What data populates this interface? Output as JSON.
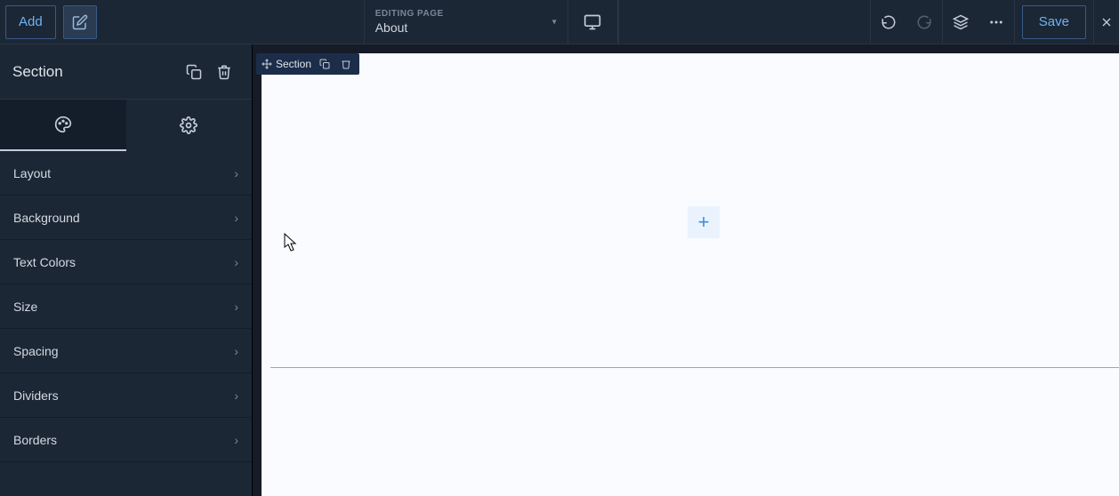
{
  "topbar": {
    "add_label": "Add",
    "page_selector": {
      "label": "EDITING PAGE",
      "name": "About"
    },
    "save_label": "Save"
  },
  "sidebar": {
    "title": "Section",
    "panels": [
      {
        "label": "Layout"
      },
      {
        "label": "Background"
      },
      {
        "label": "Text Colors"
      },
      {
        "label": "Size"
      },
      {
        "label": "Spacing"
      },
      {
        "label": "Dividers"
      },
      {
        "label": "Borders"
      }
    ]
  },
  "selection": {
    "label": "Section"
  },
  "colors": {
    "accent": "#6db3f2",
    "panel": "#1c2735"
  }
}
